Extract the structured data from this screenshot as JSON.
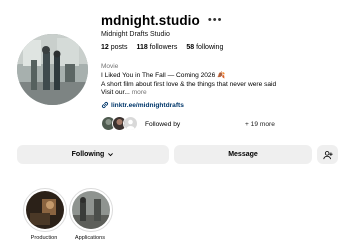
{
  "profile": {
    "username": "mdnight.studio",
    "more_icon": "•••",
    "full_name": "Midnight Drafts Studio",
    "stats": [
      {
        "count": "12",
        "label": "posts"
      },
      {
        "count": "118",
        "label": "followers"
      },
      {
        "count": "58",
        "label": "following"
      }
    ],
    "category": "Movie",
    "bio_line1": "I Liked You in The Fall — Coming 2026 🍂",
    "bio_line2": "A short film about first love & the things that never were said",
    "bio_line3": "Visit our...",
    "bio_more": "more",
    "link_text": "linktr.ee/midnightdrafts",
    "followed_by_label": "Followed by",
    "followed_by_more": "+ 19 more"
  },
  "actions": {
    "following_label": "Following",
    "message_label": "Message"
  },
  "highlights": [
    {
      "label": "Production"
    },
    {
      "label": "Applications"
    }
  ],
  "icons": {
    "link": "link-icon",
    "chevron": "chevron-down-icon",
    "suggest": "add-person-icon"
  },
  "colors": {
    "button_bg": "#efefef",
    "link": "#00376b",
    "muted": "#737373"
  }
}
